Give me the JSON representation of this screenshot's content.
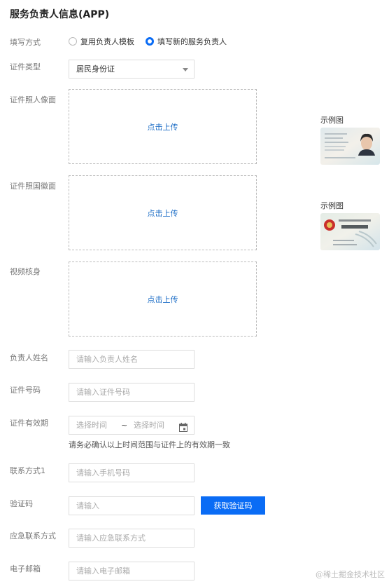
{
  "page_title": "服务负责人信息(APP)",
  "fill_mode": {
    "label": "填写方式",
    "option_template": "复用负责人模板",
    "option_new": "填写新的服务负责人",
    "selected": "填写新的服务负责人"
  },
  "id_type": {
    "label": "证件类型",
    "value": "居民身份证"
  },
  "id_front": {
    "label": "证件照人像面",
    "upload_text": "点击上传",
    "example_label": "示例图"
  },
  "id_back": {
    "label": "证件照国徽面",
    "upload_text": "点击上传",
    "example_label": "示例图"
  },
  "video": {
    "label": "视频核身",
    "upload_text": "点击上传"
  },
  "name": {
    "label": "负责人姓名",
    "placeholder": "请输入负责人姓名"
  },
  "id_number": {
    "label": "证件号码",
    "placeholder": "请输入证件号码"
  },
  "validity": {
    "label": "证件有效期",
    "start_placeholder": "选择时间",
    "separator": "~",
    "end_placeholder": "选择时间",
    "hint": "请务必确认以上时间范围与证件上的有效期一致"
  },
  "phone": {
    "label": "联系方式1",
    "placeholder": "请输入手机号码"
  },
  "code": {
    "label": "验证码",
    "placeholder": "请输入",
    "button": "获取验证码"
  },
  "emergency": {
    "label": "应急联系方式",
    "placeholder": "请输入应急联系方式"
  },
  "email": {
    "label": "电子邮箱",
    "placeholder": "请输入电子邮箱"
  },
  "watermark": "@稀土掘金技术社区",
  "colors": {
    "accent": "#0a6cf5",
    "link": "#1f6fc7",
    "border": "#dddddd"
  }
}
